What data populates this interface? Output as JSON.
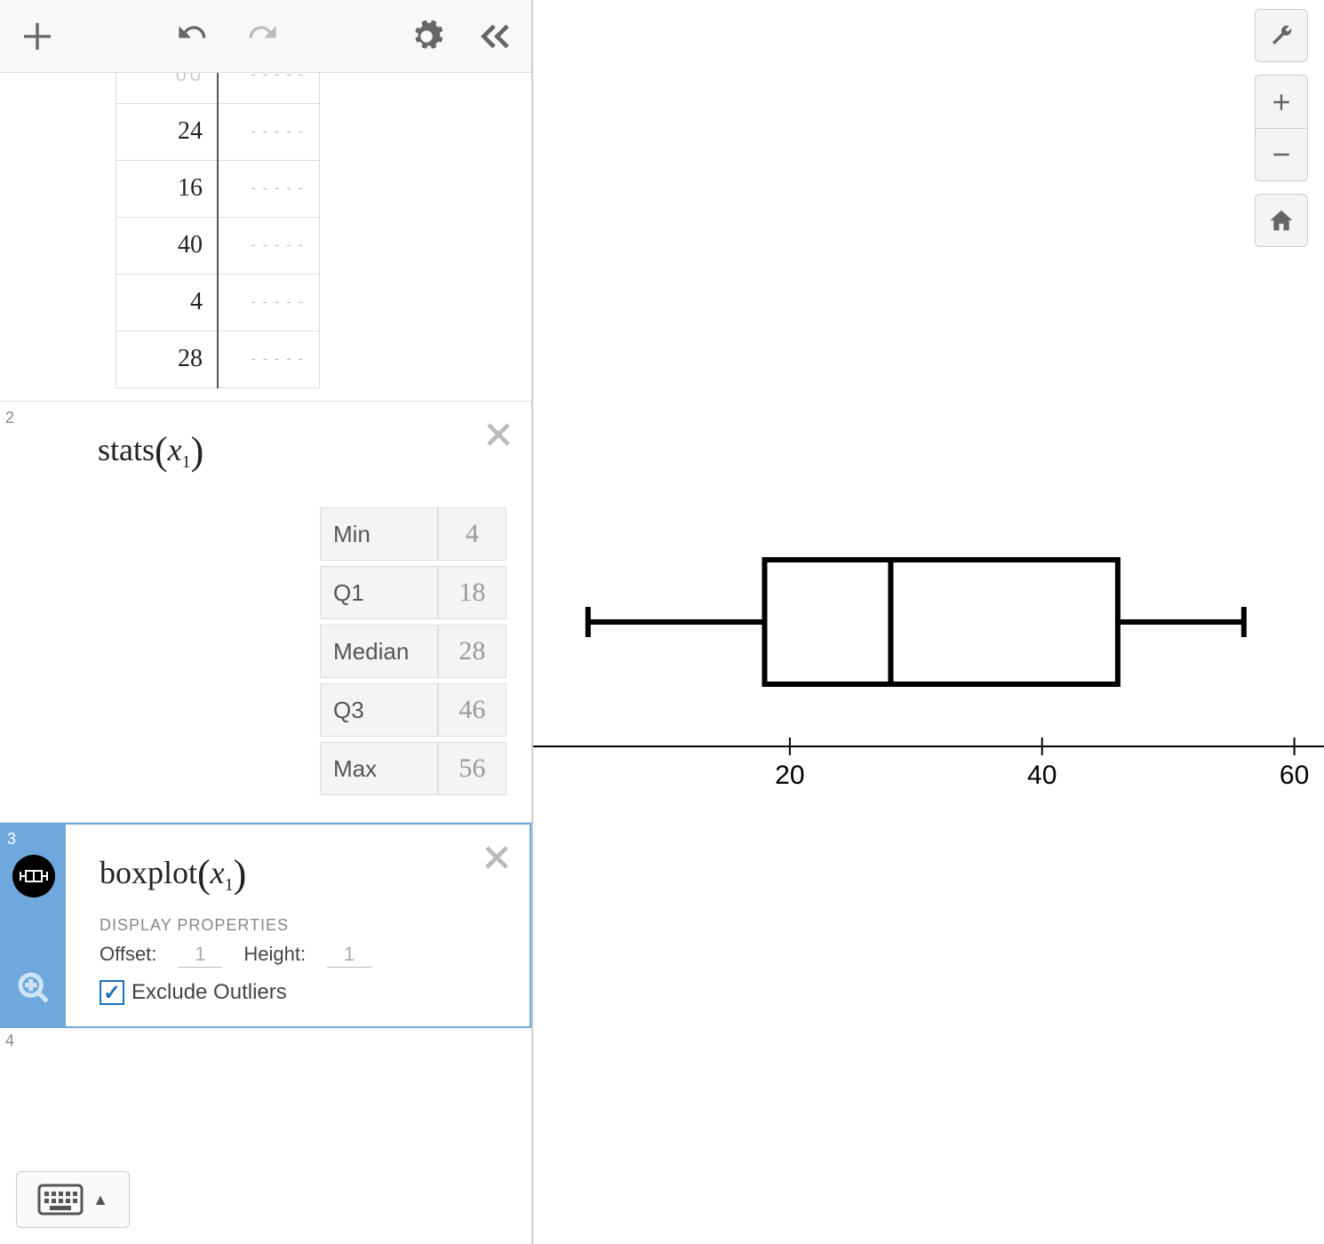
{
  "data_table": {
    "visible_rows": [
      "24",
      "16",
      "40",
      "4",
      "28"
    ]
  },
  "rows": {
    "r2": {
      "index": "2",
      "formula_name": "stats",
      "formula_arg": "x",
      "formula_sub": "1"
    },
    "r3": {
      "index": "3",
      "formula_name": "boxplot",
      "formula_arg": "x",
      "formula_sub": "1"
    },
    "r4": {
      "index": "4"
    }
  },
  "stats": {
    "labels": {
      "min": "Min",
      "q1": "Q1",
      "median": "Median",
      "q3": "Q3",
      "max": "Max"
    },
    "values": {
      "min": "4",
      "q1": "18",
      "median": "28",
      "q3": "46",
      "max": "56"
    }
  },
  "display_props": {
    "header": "DISPLAY PROPERTIES",
    "offset_label": "Offset:",
    "offset_value": "1",
    "height_label": "Height:",
    "height_value": "1",
    "exclude_outliers_label": "Exclude Outliers",
    "exclude_outliers_checked": true
  },
  "axis": {
    "ticks": [
      "20",
      "40",
      "60"
    ]
  },
  "chart_data": {
    "type": "boxplot",
    "title": "",
    "xlabel": "",
    "xlim": [
      0,
      62
    ],
    "x_ticks": [
      20,
      40,
      60
    ],
    "series": [
      {
        "name": "x1",
        "min": 4,
        "q1": 18,
        "median": 28,
        "q3": 46,
        "max": 56
      }
    ]
  }
}
